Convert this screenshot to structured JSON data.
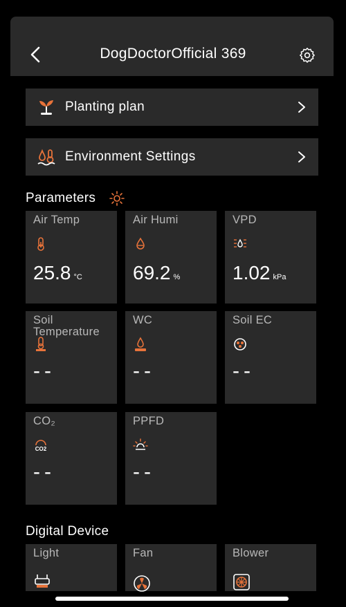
{
  "header": {
    "title": "DogDoctorOfficial 369"
  },
  "menu": {
    "planting_label": "Planting plan",
    "environment_label": "Environment Settings"
  },
  "parameters": {
    "title": "Parameters",
    "air_temp": {
      "name": "Air Temp",
      "value": "25.8",
      "unit": "°C"
    },
    "air_humi": {
      "name": "Air Humi",
      "value": "69.2",
      "unit": "%"
    },
    "vpd": {
      "name": "VPD",
      "value": "1.02",
      "unit": "kPa"
    },
    "soil_temp": {
      "name": "Soil Temperature",
      "value": "--"
    },
    "wc": {
      "name": "WC",
      "value": "--"
    },
    "soil_ec": {
      "name": "Soil EC",
      "value": "--"
    },
    "co2": {
      "name": "CO₂",
      "value": "--"
    },
    "ppfd": {
      "name": "PPFD",
      "value": "--"
    }
  },
  "devices": {
    "title": "Digital Device",
    "light": {
      "name": "Light"
    },
    "fan": {
      "name": "Fan"
    },
    "blower": {
      "name": "Blower"
    }
  },
  "accent": "#e8733a"
}
